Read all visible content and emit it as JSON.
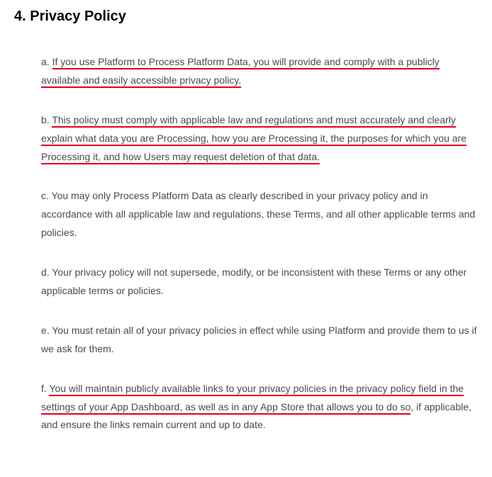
{
  "section": {
    "heading": "4. Privacy Policy",
    "items": {
      "a": {
        "marker": "a. ",
        "hl1": "If you use Platform to Process Platform Data, you will provide and comply with a publicly available and easily accessible privacy policy.",
        "tail": ""
      },
      "b": {
        "marker": "b. ",
        "hl1": "This policy must comply with applicable law and regulations and must accurately and clearly explain what data you are Processing, how you are Processing it, the purposes for which you are Processing it, and how Users may request deletion of that data.",
        "tail": ""
      },
      "c": {
        "marker": "c. ",
        "text": "You may only Process Platform Data as clearly described in your privacy policy and in accordance with all applicable law and regulations, these Terms, and all other applicable terms and policies."
      },
      "d": {
        "marker": "d. ",
        "text": "Your privacy policy will not supersede, modify, or be inconsistent with these Terms or any other applicable terms or policies."
      },
      "e": {
        "marker": "e. ",
        "text": "You must retain all of your privacy policies in effect while using Platform and provide them to us if we ask for them."
      },
      "f": {
        "marker": "f. ",
        "hl1": "You will maintain publicly available links to your privacy policies in the privacy policy field in the settings of your App Dashboard, as well as in any App Store that allows you to do so",
        "tail": ", if applicable, and ensure the links remain current and up to date."
      }
    }
  }
}
